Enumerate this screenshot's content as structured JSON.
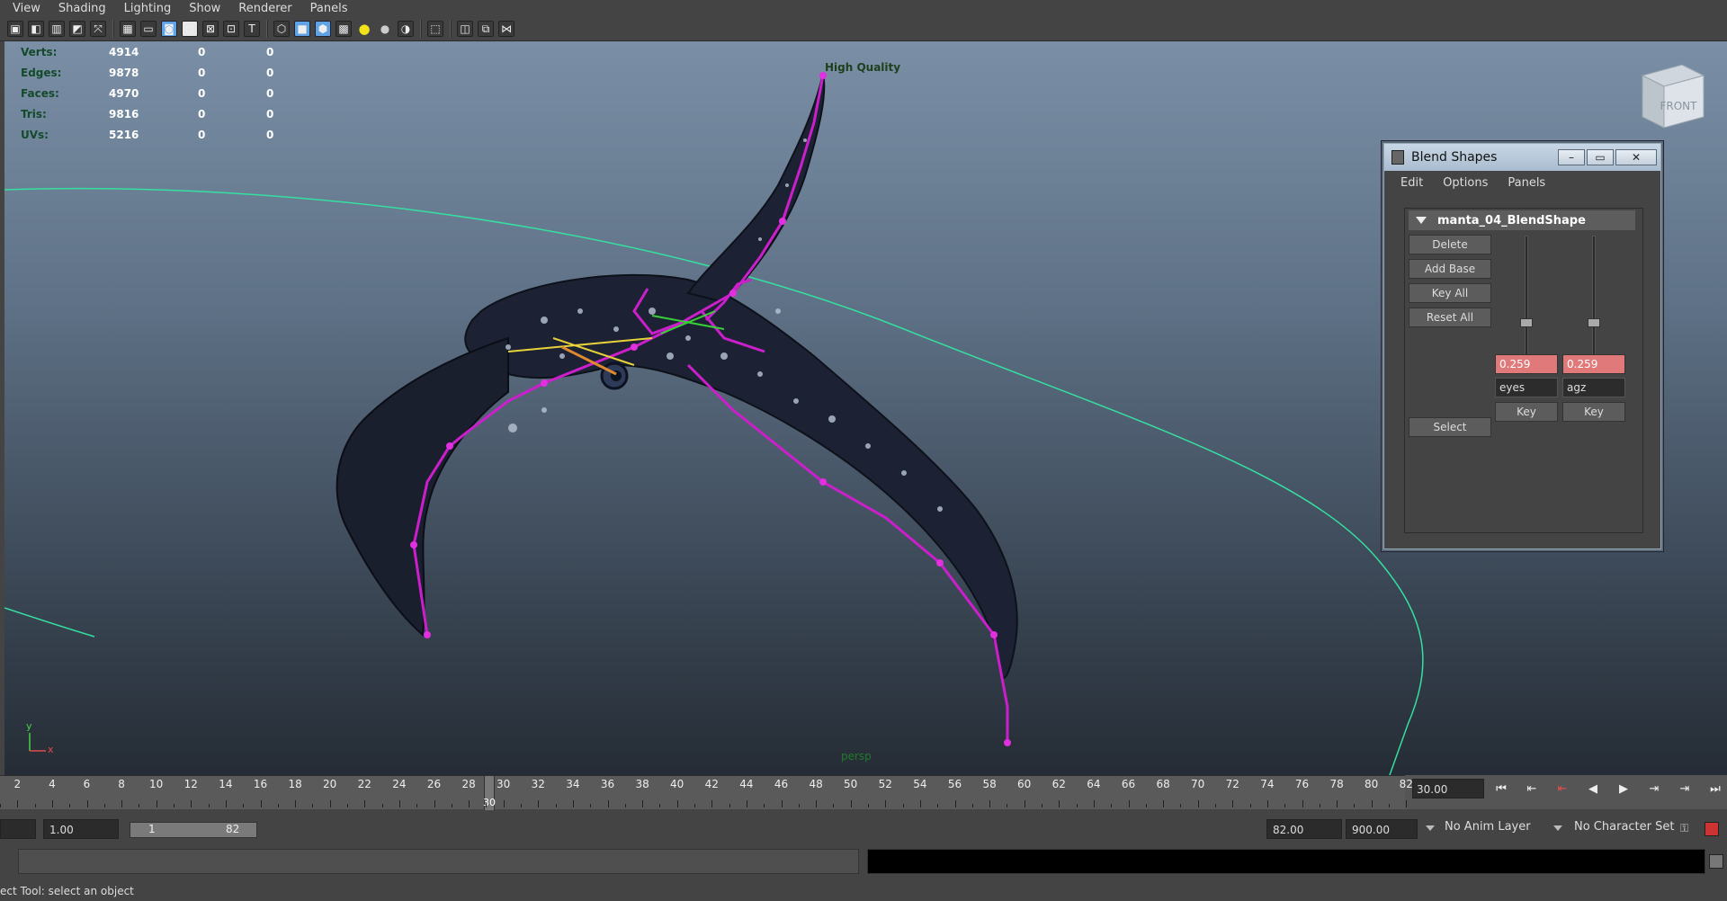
{
  "menu": [
    "View",
    "Shading",
    "Lighting",
    "Show",
    "Renderer",
    "Panels"
  ],
  "toolbar_icons": [
    "select-camera-icon",
    "camera-attributes-icon",
    "bookmark-icon",
    "image-plane-icon",
    "2d-pan-zoom-icon",
    "grease-pencil-icon",
    "grid-icon",
    "film-gate-icon",
    "resolution-gate-icon",
    "gate-mask-icon",
    "field-chart-icon",
    "safe-action-icon",
    "wireframe-icon",
    "smooth-shade-icon",
    "textured-icon",
    "wireframe-on-shaded-icon",
    "use-default-light-icon",
    "shadows-icon",
    "ambient-occlusion-icon",
    "isolate-select-icon",
    "xray-icon",
    "xray-joints-icon",
    "component-xray-icon"
  ],
  "hud": {
    "rows": [
      {
        "label": "Verts:",
        "a": "4914",
        "b": "0",
        "c": "0"
      },
      {
        "label": "Edges:",
        "a": "9878",
        "b": "0",
        "c": "0"
      },
      {
        "label": "Faces:",
        "a": "4970",
        "b": "0",
        "c": "0"
      },
      {
        "label": "Tris:",
        "a": "9816",
        "b": "0",
        "c": "0"
      },
      {
        "label": "UVs:",
        "a": "5216",
        "b": "0",
        "c": "0"
      }
    ],
    "quality": "High Quality",
    "camera": "persp",
    "viewcube": "FRONT",
    "axis_x": "x",
    "axis_y": "y"
  },
  "blend_shapes": {
    "title": "Blend Shapes",
    "window_buttons": {
      "minimize": "–",
      "maximize": "▭",
      "close": "✕"
    },
    "menu": [
      "Edit",
      "Options",
      "Panels"
    ],
    "node": "manta_04_BlendShape",
    "buttons": {
      "delete": "Delete",
      "add_base": "Add Base",
      "key_all": "Key All",
      "reset_all": "Reset All",
      "select": "Select"
    },
    "targets": [
      {
        "name": "eyes",
        "value": "0.259",
        "key": "Key",
        "weight": 0.259
      },
      {
        "name": "agz",
        "value": "0.259",
        "key": "Key",
        "weight": 0.259
      }
    ]
  },
  "timeline": {
    "ticks": [
      2,
      4,
      6,
      8,
      10,
      12,
      14,
      16,
      18,
      20,
      22,
      24,
      26,
      28,
      30,
      32,
      34,
      36,
      38,
      40,
      42,
      44,
      46,
      48,
      50,
      52,
      54,
      56,
      58,
      60,
      62,
      64,
      66,
      68,
      70,
      72,
      74,
      76,
      78,
      80,
      82
    ],
    "current_frame": "30",
    "current_time": "30.00"
  },
  "playback": [
    "go-to-start-icon",
    "step-back-key-icon",
    "step-back-frame-icon",
    "play-backwards-icon",
    "play-forwards-icon",
    "step-forward-frame-icon",
    "step-forward-key-icon",
    "go-to-end-icon"
  ],
  "range": {
    "start_field": "1.00",
    "slider_start": "1",
    "slider_end": "82",
    "end_field": "82.00",
    "anim_end": "900.00",
    "anim_layer": "No Anim Layer",
    "char_set": "No Character Set"
  },
  "help": "ect Tool: select an object",
  "colors": {
    "skeleton": "#cc1fcc",
    "curve": "#35e0a0",
    "keyvalue": "#e07a7a"
  }
}
